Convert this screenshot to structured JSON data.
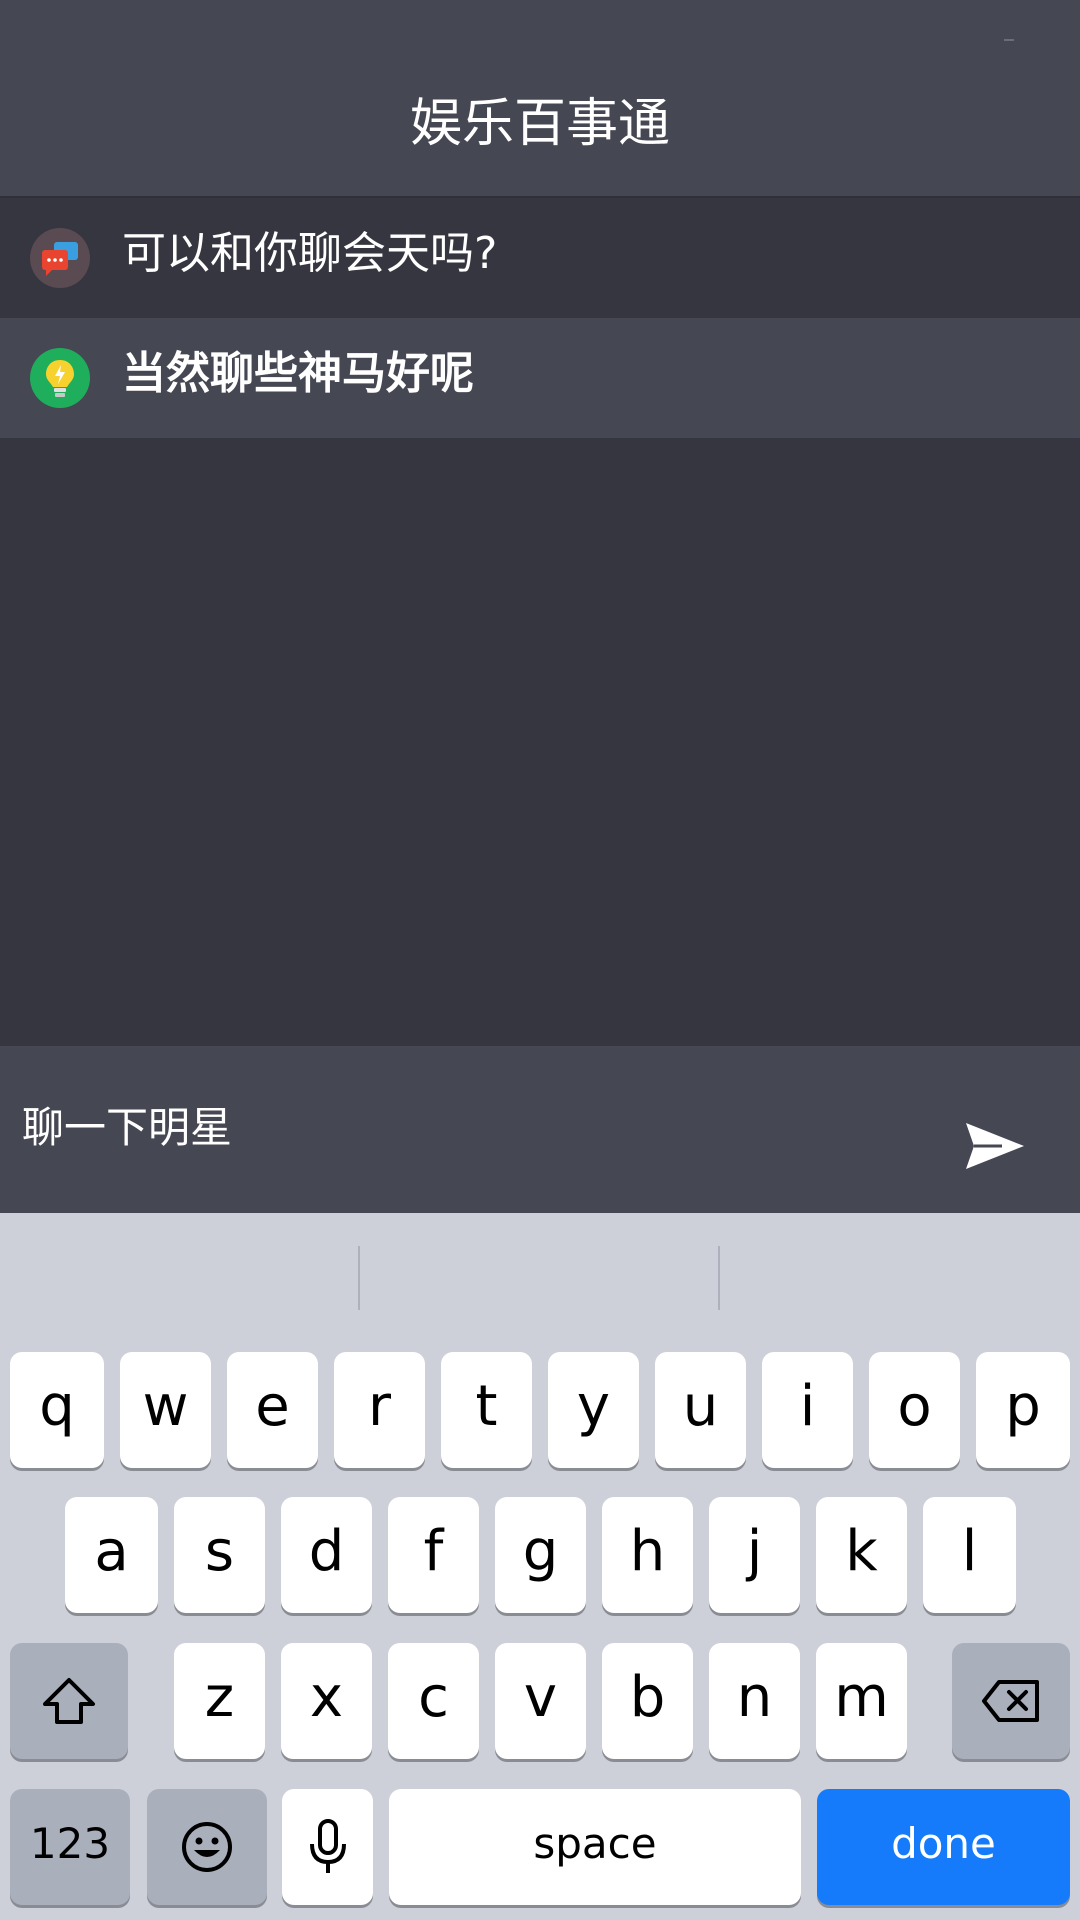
{
  "header": {
    "title": "娱乐百事通"
  },
  "messages": [
    {
      "sender": "user",
      "icon": "chat-bubbles-icon",
      "text": "可以和你聊会天吗?"
    },
    {
      "sender": "bot",
      "icon": "lightbulb-icon",
      "text": "当然聊些神马好呢"
    }
  ],
  "composer": {
    "input_value": "聊一下明星",
    "send_icon": "send-icon"
  },
  "keyboard": {
    "row1": [
      "q",
      "w",
      "e",
      "r",
      "t",
      "y",
      "u",
      "i",
      "o",
      "p"
    ],
    "row2": [
      "a",
      "s",
      "d",
      "f",
      "g",
      "h",
      "j",
      "k",
      "l"
    ],
    "row3": [
      "z",
      "x",
      "c",
      "v",
      "b",
      "n",
      "m"
    ],
    "shift_icon": "shift-icon",
    "backspace_icon": "backspace-icon",
    "numbers_label": "123",
    "emoji_icon": "emoji-icon",
    "mic_icon": "microphone-icon",
    "space_label": "space",
    "done_label": "done"
  },
  "colors": {
    "header_bg": "#454753",
    "chat_bg": "#363640",
    "done_key": "#157bfb"
  }
}
